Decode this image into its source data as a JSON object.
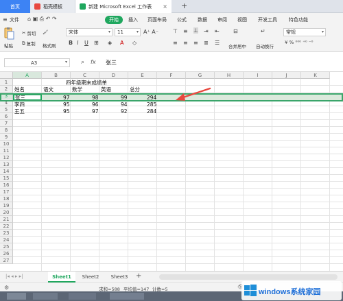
{
  "tabs": {
    "home": "首页",
    "template": "稻壳模板",
    "workbook": "新建 Microsoft Excel 工作表"
  },
  "ribbon": {
    "file": "文件",
    "menus": [
      "开始",
      "插入",
      "页面布局",
      "公式",
      "数据",
      "审阅",
      "视图",
      "开发工具",
      "特色功能"
    ],
    "paste": "粘贴",
    "cut": "剪切",
    "copy": "复制",
    "format_painter": "格式刷",
    "font_name": "宋体",
    "font_size": "11",
    "merge_center": "合并居中",
    "wrap_text": "自动换行",
    "number_format": "常规"
  },
  "formula_bar": {
    "name_box": "A3",
    "fx": "fx",
    "content": "张三"
  },
  "columns": [
    "A",
    "B",
    "C",
    "D",
    "E",
    "F",
    "G",
    "H",
    "I",
    "J",
    "K"
  ],
  "rows": [
    "1",
    "2",
    "3",
    "4",
    "5",
    "6",
    "7",
    "8",
    "9",
    "10",
    "11",
    "12",
    "13",
    "14",
    "15",
    "16",
    "17",
    "18",
    "19",
    "20",
    "21",
    "22",
    "23",
    "24",
    "25",
    "26",
    "27"
  ],
  "sheet": {
    "title": "四年级期末成绩单",
    "headers": [
      "姓名",
      "语文",
      "数学",
      "英语",
      "总分"
    ],
    "data": [
      [
        "张三",
        "97",
        "98",
        "99",
        "294"
      ],
      [
        "李四",
        "95",
        "96",
        "94",
        "285"
      ],
      [
        "王五",
        "95",
        "97",
        "92",
        "284"
      ]
    ]
  },
  "sheet_tabs": [
    "Sheet1",
    "Sheet2",
    "Sheet3"
  ],
  "status": {
    "sum": "求和=588",
    "avg": "平均值=147",
    "count": "计数=5"
  },
  "watermark": "windows系统家园",
  "colors": {
    "accent": "#1fa75e",
    "home_tab": "#3d83f4",
    "arrow": "#e8493f"
  }
}
